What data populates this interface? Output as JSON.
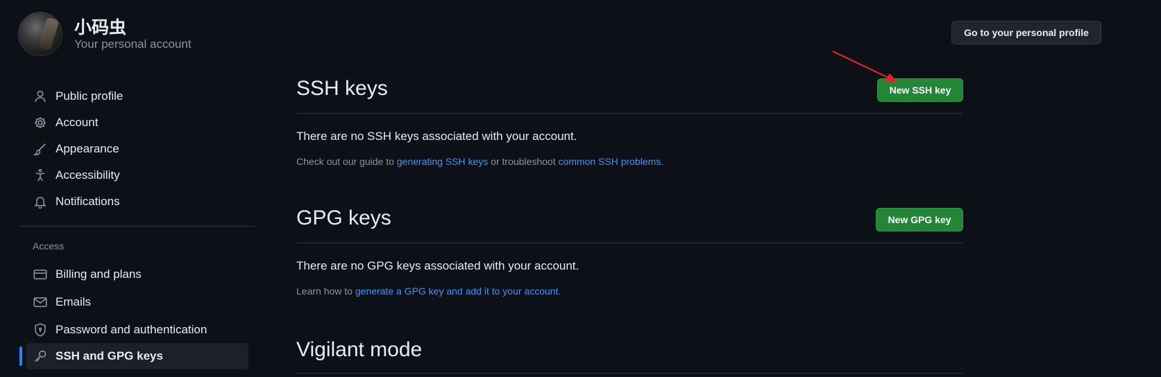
{
  "header": {
    "user_name": "小码虫",
    "subtitle": "Your personal account",
    "profile_button": "Go to your personal profile"
  },
  "sidebar": {
    "items": [
      {
        "label": "Public profile",
        "icon": "person-icon"
      },
      {
        "label": "Account",
        "icon": "gear-icon"
      },
      {
        "label": "Appearance",
        "icon": "paintbrush-icon"
      },
      {
        "label": "Accessibility",
        "icon": "accessibility-icon"
      },
      {
        "label": "Notifications",
        "icon": "bell-icon"
      }
    ],
    "access_group": {
      "title": "Access",
      "items": [
        {
          "label": "Billing and plans",
          "icon": "credit-card-icon"
        },
        {
          "label": "Emails",
          "icon": "mail-icon"
        },
        {
          "label": "Password and authentication",
          "icon": "shield-icon"
        },
        {
          "label": "SSH and GPG keys",
          "icon": "key-icon",
          "active": true
        }
      ]
    }
  },
  "ssh": {
    "title": "SSH keys",
    "new_button": "New SSH key",
    "empty": "There are no SSH keys associated with your account.",
    "help_prefix": "Check out our guide to ",
    "help_link1": "generating SSH keys",
    "help_middle": " or troubleshoot ",
    "help_link2": "common SSH problems",
    "help_suffix": "."
  },
  "gpg": {
    "title": "GPG keys",
    "new_button": "New GPG key",
    "empty": "There are no GPG keys associated with your account.",
    "help_prefix": "Learn how to ",
    "help_link": "generate a GPG key and add it to your account",
    "help_suffix": "."
  },
  "vigilant": {
    "title": "Vigilant mode"
  },
  "colors": {
    "background": "#0d1117",
    "accent_link": "#4493f8",
    "primary_button": "#238636",
    "active_indicator": "#2f81f7",
    "annotation_arrow": "#e5212b"
  }
}
